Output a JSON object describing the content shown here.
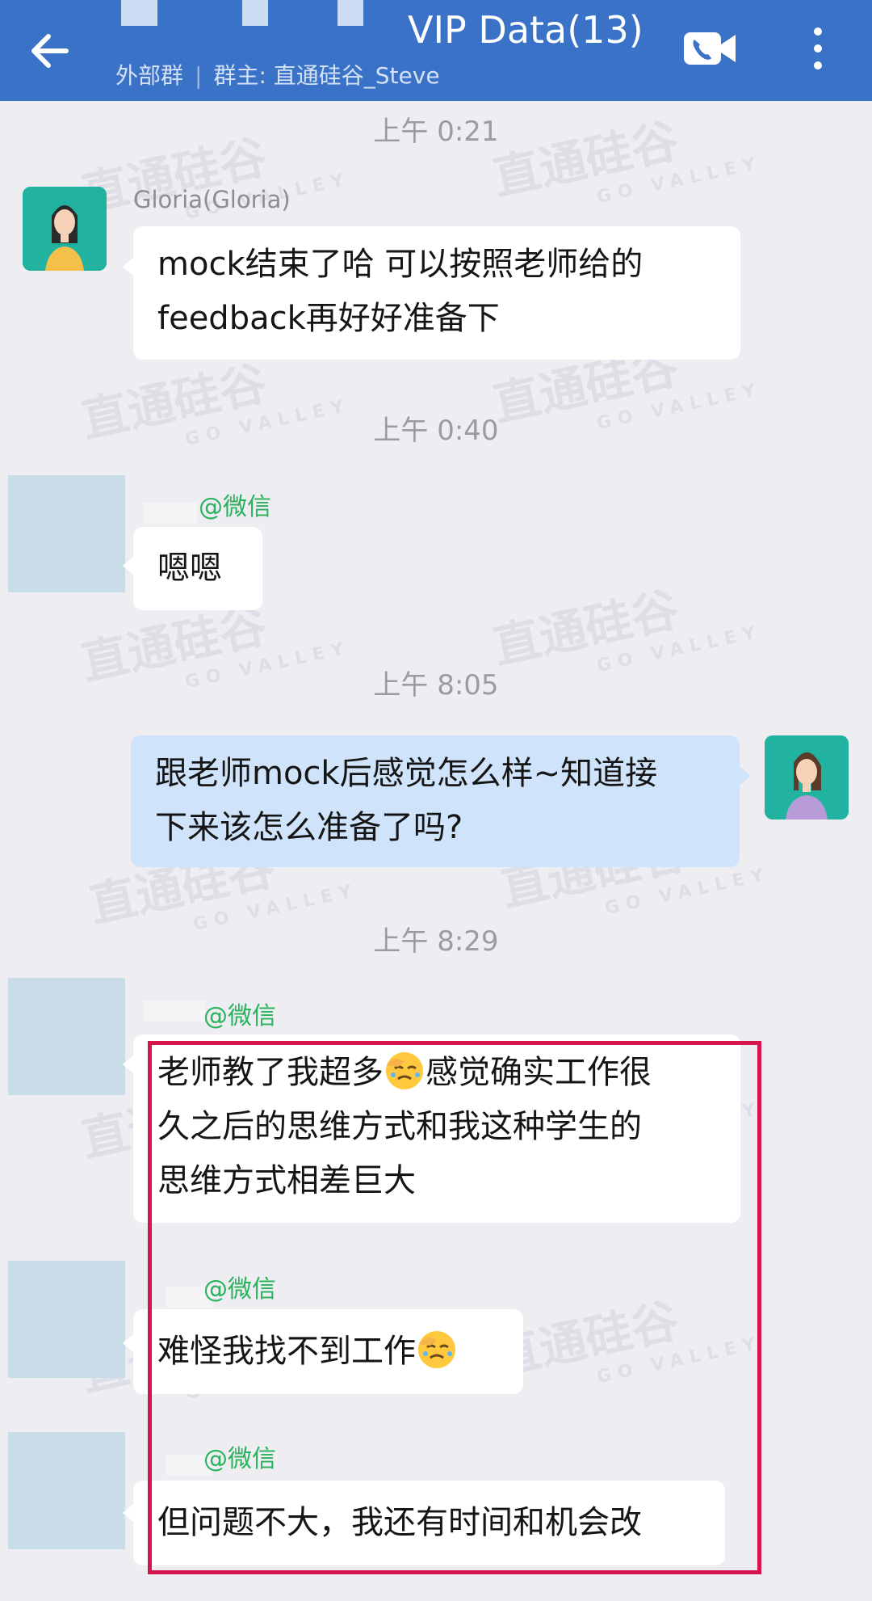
{
  "header": {
    "title": "VIP Data(13)",
    "group_type": "外部群",
    "owner": "群主: 直通硅谷_Steve",
    "bg_color": "#3A72C7"
  },
  "icons": [
    "back-arrow-icon",
    "video-call-icon",
    "more-vertical-icon",
    "facepalm-emoji-icon"
  ],
  "watermark": {
    "brand": "直通硅谷",
    "sub": "GO VALLEY"
  },
  "messages": [
    {
      "time": "上午 0:21",
      "sender": "Gloria(Gloria)",
      "lines": [
        "mock结束了哈  可以按照老师给的",
        "feedback再好好准备下"
      ]
    },
    {
      "time": "上午 0:40",
      "sender_tag": "@微信",
      "lines": [
        "嗯嗯"
      ]
    },
    {
      "time": "上午 8:05",
      "lines": [
        "跟老师mock后感觉怎么样~知道接",
        "下来该怎么准备了吗?"
      ]
    },
    {
      "time": "上午 8:29",
      "sender_tag": "@微信",
      "lines": [
        "老师教了我超多",
        "感觉确实工作很",
        "久之后的思维方式和我这种学生的",
        "思维方式相差巨大"
      ]
    },
    {
      "sender_tag": "@微信",
      "lines": [
        "难怪我找不到工作"
      ]
    },
    {
      "sender_tag": "@微信",
      "lines": [
        "但问题不大，我还有时间和机会改"
      ]
    }
  ]
}
